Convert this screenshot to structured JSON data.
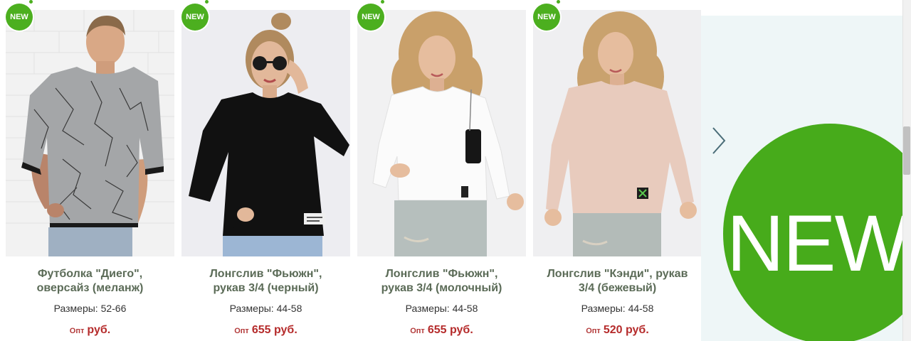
{
  "badge_text": "NEW",
  "colors": {
    "badge": "#4caf1f",
    "title": "#5b6b57",
    "price": "#b52b2b",
    "promo_bg": "#eef6f7",
    "promo_circle": "#47ab1b"
  },
  "products": [
    {
      "title_line1": "Футболка \"Диего\",",
      "title_line2": "оверсайз (меланж)",
      "sizes": "Размеры: 52-66",
      "price_label": "Опт",
      "price": "руб."
    },
    {
      "title_line1": "Лонгслив \"Фьюжн\",",
      "title_line2": "рукав 3/4 (черный)",
      "sizes": "Размеры: 44-58",
      "price_label": "Опт",
      "price": "655 руб."
    },
    {
      "title_line1": "Лонгслив \"Фьюжн\",",
      "title_line2": "рукав 3/4 (молочный)",
      "sizes": "Размеры: 44-58",
      "price_label": "Опт",
      "price": "655 руб."
    },
    {
      "title_line1": "Лонгслив \"Кэнди\", рукав",
      "title_line2": "3/4 (бежевый)",
      "sizes": "Размеры: 44-58",
      "price_label": "Опт",
      "price": "520 руб."
    }
  ],
  "promo": {
    "text": "NEW"
  },
  "icons": {
    "next": "chevron-right-icon"
  }
}
